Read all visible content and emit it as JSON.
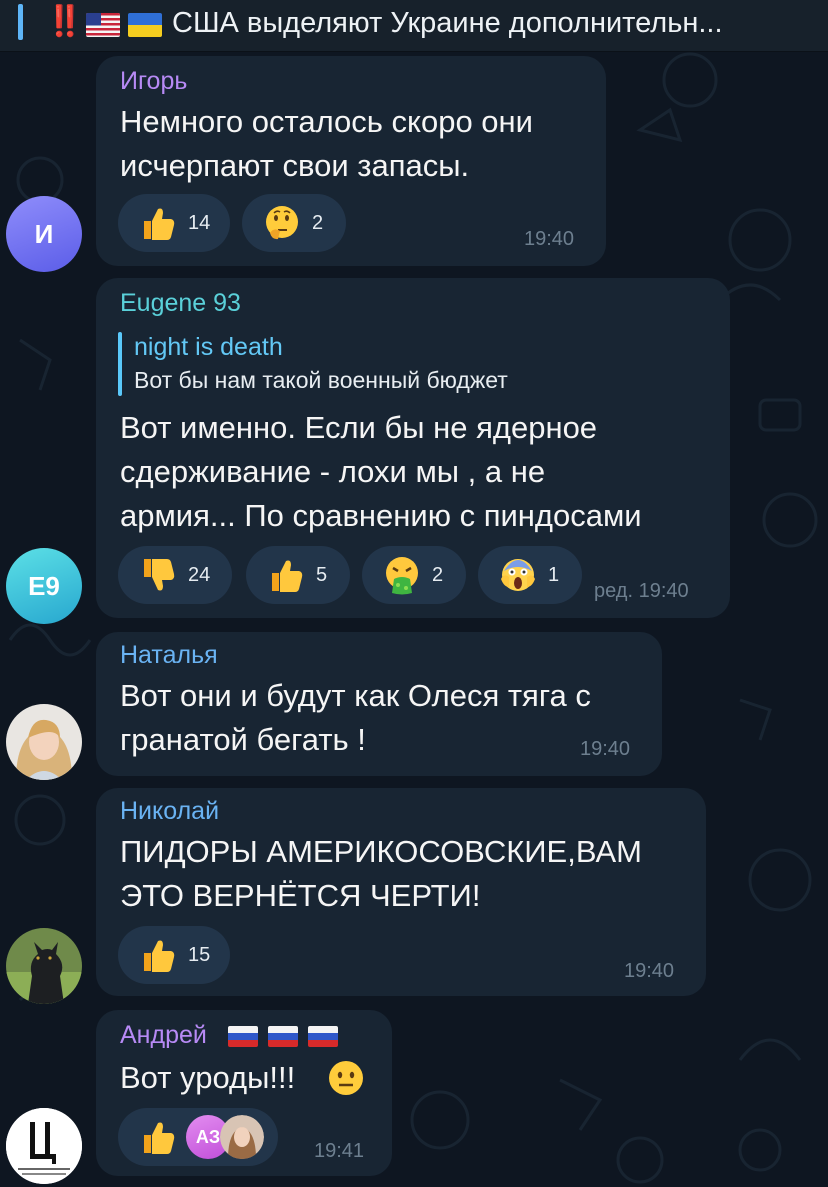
{
  "pinned": {
    "marks": "‼️",
    "title": "США выделяют Украине дополнительн..."
  },
  "messages": [
    {
      "author": "Игорь",
      "author_color": "#b78af5",
      "avatar_initial": "И",
      "lines": [
        "Немного осталось скоро они",
        "исчерпают свои запасы."
      ],
      "reactions": [
        {
          "emoji": "thumbs-up",
          "count": "14"
        },
        {
          "emoji": "thinking-face",
          "count": "2"
        }
      ],
      "time": "19:40"
    },
    {
      "author": "Eugene 93",
      "author_color": "#5ad0d9",
      "avatar_initial": "E9",
      "reply": {
        "author": "night is death",
        "text": "Вот бы нам такой военный бюджет"
      },
      "lines": [
        "Вот именно. Если  бы не  ядерное",
        "сдерживание - лохи мы , а не",
        "армия... По сравнению с пиндосами"
      ],
      "reactions": [
        {
          "emoji": "thumbs-down",
          "count": "24"
        },
        {
          "emoji": "thumbs-up",
          "count": "5"
        },
        {
          "emoji": "vomiting-face",
          "count": "2"
        },
        {
          "emoji": "screaming-face",
          "count": "1"
        }
      ],
      "time": "ред. 19:40"
    },
    {
      "author": "Наталья",
      "author_color": "#6ab3f3",
      "lines": [
        "Вот они и будут как Олеся тяга с",
        "гранатой бегать !"
      ],
      "time": "19:40"
    },
    {
      "author": "Николай",
      "author_color": "#6ab3f3",
      "lines": [
        "ПИДОРЫ АМЕРИКОСОВСКИЕ,ВАМ",
        "ЭТО ВЕРНЁТСЯ ЧЕРТИ!"
      ],
      "reactions": [
        {
          "emoji": "thumbs-up",
          "count": "15"
        }
      ],
      "time": "19:40"
    },
    {
      "author": "Андрей",
      "author_color": "#b78af5",
      "lines": [
        "Вот уроды!!!"
      ],
      "reactions": [
        {
          "emoji": "thumbs-up",
          "reactor_initials": "АЗ"
        }
      ],
      "time": "19:41"
    }
  ],
  "colors": {
    "background": "#0e1621",
    "bubble": "#182533",
    "reaction_chip": "#22354a",
    "time": "#6d7f8f",
    "accent": "#5eb5f7"
  }
}
